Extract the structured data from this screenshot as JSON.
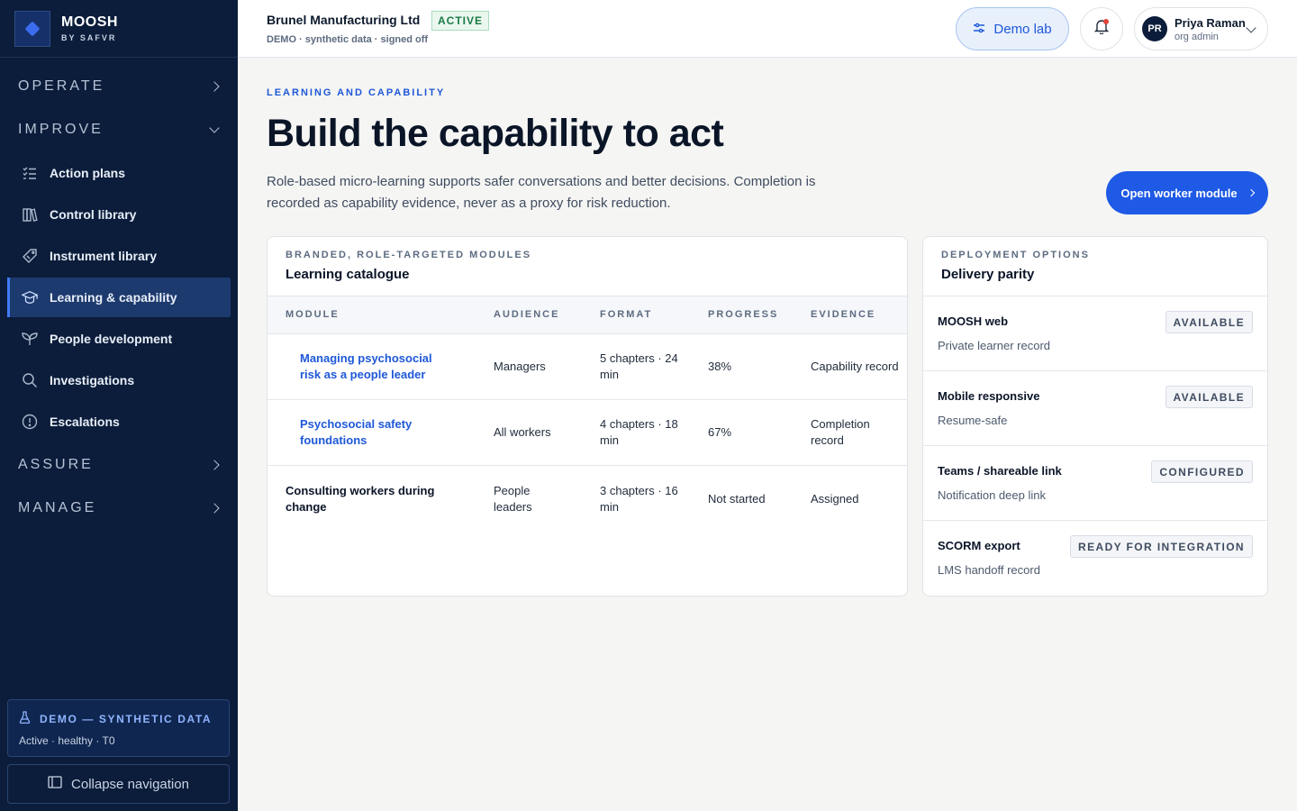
{
  "brand": {
    "name": "MOOSH",
    "sub": "BY SAFVR"
  },
  "sidebar": {
    "sections": [
      {
        "label": "OPERATE",
        "expanded": false
      },
      {
        "label": "IMPROVE",
        "expanded": true
      },
      {
        "label": "ASSURE",
        "expanded": false
      },
      {
        "label": "MANAGE",
        "expanded": false
      }
    ],
    "items": [
      {
        "label": "Action plans",
        "icon": "list-check-icon"
      },
      {
        "label": "Control library",
        "icon": "books-icon"
      },
      {
        "label": "Instrument library",
        "icon": "tag-icon"
      },
      {
        "label": "Learning & capability",
        "icon": "graduation-cap-icon",
        "active": true
      },
      {
        "label": "People development",
        "icon": "sprout-icon"
      },
      {
        "label": "Investigations",
        "icon": "search-icon"
      },
      {
        "label": "Escalations",
        "icon": "alert-circle-icon"
      }
    ],
    "demo": {
      "title": "DEMO — SYNTHETIC DATA",
      "status": "Active · healthy · T0"
    },
    "collapse_label": "Collapse navigation"
  },
  "header": {
    "org_name": "Brunel Manufacturing Ltd",
    "org_status": "ACTIVE",
    "org_meta": "DEMO · synthetic data · signed off",
    "demo_lab_label": "Demo lab",
    "user": {
      "initials": "PR",
      "name": "Priya Raman",
      "role": "org admin"
    }
  },
  "main": {
    "eyebrow": "LEARNING AND CAPABILITY",
    "title": "Build the capability to act",
    "description": "Role-based micro-learning supports safer conversations and better decisions. Completion is recorded as capability evidence, never as a proxy for risk reduction.",
    "primary_button": "Open worker module"
  },
  "catalogue": {
    "eyebrow": "BRANDED, ROLE-TARGETED MODULES",
    "title": "Learning catalogue",
    "columns": [
      "MODULE",
      "AUDIENCE",
      "FORMAT",
      "PROGRESS",
      "EVIDENCE"
    ],
    "rows": [
      {
        "module": "Managing psychosocial risk as a people leader",
        "audience": "Managers",
        "format": "5 chapters · 24 min",
        "progress": "38%",
        "evidence": "Capability record",
        "link": true
      },
      {
        "module": "Psychosocial safety foundations",
        "audience": "All workers",
        "format": "4 chapters · 18 min",
        "progress": "67%",
        "evidence": "Completion record",
        "link": true
      },
      {
        "module": "Consulting workers during change",
        "audience": "People leaders",
        "format": "3 chapters · 16 min",
        "progress": "Not started",
        "evidence": "Assigned",
        "link": false
      }
    ]
  },
  "delivery": {
    "eyebrow": "DEPLOYMENT OPTIONS",
    "title": "Delivery parity",
    "options": [
      {
        "name": "MOOSH web",
        "desc": "Private learner record",
        "status": "AVAILABLE"
      },
      {
        "name": "Mobile responsive",
        "desc": "Resume-safe",
        "status": "AVAILABLE"
      },
      {
        "name": "Teams / shareable link",
        "desc": "Notification deep link",
        "status": "CONFIGURED"
      },
      {
        "name": "SCORM export",
        "desc": "LMS handoff record",
        "status": "READY FOR INTEGRATION"
      }
    ]
  },
  "colors": {
    "sidebar_bg": "#0b1d3a",
    "accent": "#1e5ae6",
    "active_item": "#1d3a6e",
    "success": "#1b7a46"
  }
}
